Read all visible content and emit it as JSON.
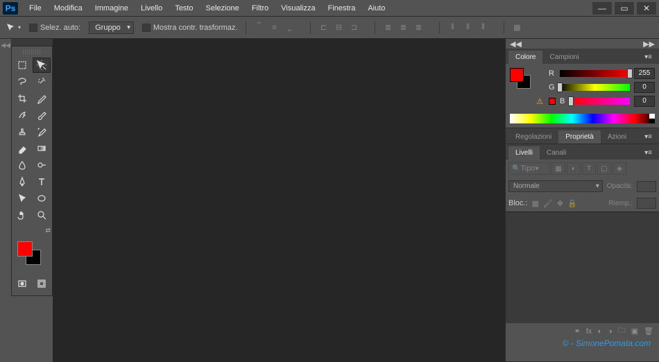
{
  "menu": [
    "File",
    "Modifica",
    "Immagine",
    "Livello",
    "Testo",
    "Selezione",
    "Filtro",
    "Visualizza",
    "Finestra",
    "Aiuto"
  ],
  "options": {
    "auto_select_label": "Selez. auto:",
    "group_label": "Gruppo",
    "show_transform_label": "Mostra contr. trasformaz."
  },
  "color_panel": {
    "tabs": [
      "Colore",
      "Campioni"
    ],
    "channels": [
      {
        "label": "R",
        "value": "255",
        "pos": 100,
        "track": "r",
        "warn": ""
      },
      {
        "label": "G",
        "value": "0",
        "pos": 0,
        "track": "g",
        "warn": ""
      },
      {
        "label": "B",
        "value": "0",
        "pos": 0,
        "track": "b",
        "warn": "⚠"
      }
    ],
    "foreground": "#ff0000",
    "background": "#000000"
  },
  "adjust_panel": {
    "tabs": [
      "Regolazioni",
      "Proprietà",
      "Azioni"
    ],
    "active": 1
  },
  "layers_panel": {
    "tabs": [
      "Livelli",
      "Canali"
    ],
    "kind_label": "Tipo",
    "blend_mode": "Normale",
    "opacity_label": "Opacità:",
    "lock_label": "Bloc.:",
    "fill_label": "Riemp.:"
  },
  "watermark": "© - SimonePomata.com"
}
